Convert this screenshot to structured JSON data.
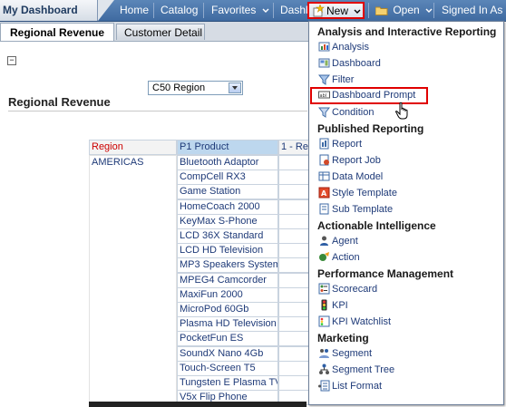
{
  "header": {
    "dashboard_title": "My Dashboard",
    "nav": {
      "home": "Home",
      "catalog": "Catalog",
      "favorites": "Favorites",
      "dashboards": "Dashb",
      "new": "New",
      "open": "Open",
      "signed_in": "Signed In As"
    }
  },
  "tabs": {
    "active": "Regional Revenue",
    "other": "Customer Detail"
  },
  "prompt": {
    "selected_value": "C50 Region"
  },
  "section": {
    "title": "Regional Revenue"
  },
  "table": {
    "headers": {
      "region": "Region",
      "product": "P1 Product",
      "revenue": "1 - Re"
    },
    "region_value": "AMERICAS",
    "products": [
      "Bluetooth Adaptor",
      "CompCell RX3",
      "Game Station",
      "HomeCoach 2000",
      "KeyMax S-Phone",
      "LCD 36X Standard",
      "LCD HD Television",
      "MP3 Speakers System",
      "MPEG4 Camcorder",
      "MaxiFun 2000",
      "MicroPod 60Gb",
      "Plasma HD Television",
      "PocketFun ES",
      "SoundX Nano 4Gb",
      "Touch-Screen T5",
      "Tungsten E Plasma TV",
      "V5x Flip Phone"
    ]
  },
  "new_menu": {
    "sections": [
      {
        "title": "Analysis and Interactive Reporting",
        "items": [
          "Analysis",
          "Dashboard",
          "Filter",
          "Dashboard Prompt",
          "Condition"
        ]
      },
      {
        "title": "Published Reporting",
        "items": [
          "Report",
          "Report Job",
          "Data Model",
          "Style Template",
          "Sub Template"
        ]
      },
      {
        "title": "Actionable Intelligence",
        "items": [
          "Agent",
          "Action"
        ]
      },
      {
        "title": "Performance Management",
        "items": [
          "Scorecard",
          "KPI",
          "KPI Watchlist"
        ]
      },
      {
        "title": "Marketing",
        "items": [
          "Segment",
          "Segment Tree",
          "List Format"
        ]
      }
    ]
  },
  "colors": {
    "topbar": "#4a75aa",
    "highlight": "#e00000",
    "link": "#1e3a78",
    "header_blue": "#bdd7ee",
    "region_red": "#cc0000"
  }
}
